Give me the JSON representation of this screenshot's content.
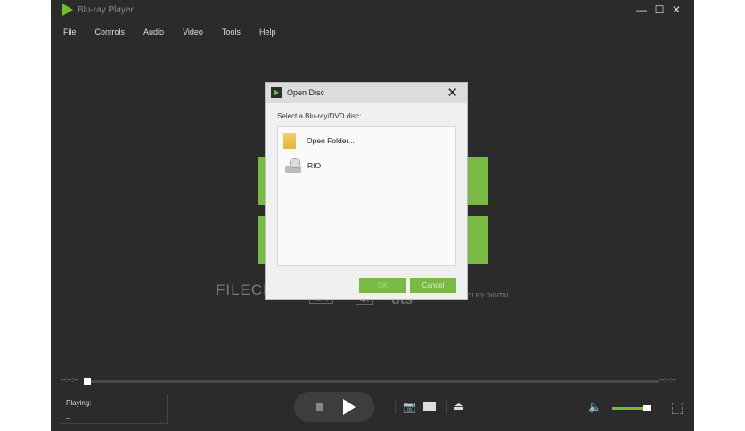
{
  "app": {
    "title": "Blu-ray Player",
    "window_controls": [
      "—",
      "☐",
      "✕"
    ]
  },
  "menu": [
    "File",
    "Controls",
    "Audio",
    "Video",
    "Tools",
    "Help"
  ],
  "dialog": {
    "title": "Open Disc",
    "close": "✕",
    "label": "Select a Blu-ray/DVD disc:",
    "items": [
      {
        "label": "Open Folder...",
        "icon": "folder-icon"
      },
      {
        "label": "RIO",
        "icon": "disc-drive-icon"
      }
    ],
    "ok": "OK",
    "cancel": "Cancel"
  },
  "logos": [
    "HEVC",
    "4K",
    "dts",
    "DOLBY DIGITAL"
  ],
  "watermark": "FILECR",
  "player": {
    "time_left": "--:--:--",
    "time_right": "--:--:--",
    "playing_label": "Playing:",
    "playing_value": "–",
    "progress": 0,
    "volume": 0.85
  },
  "colors": {
    "accent": "#7ab945",
    "background": "#2b2b2b"
  }
}
